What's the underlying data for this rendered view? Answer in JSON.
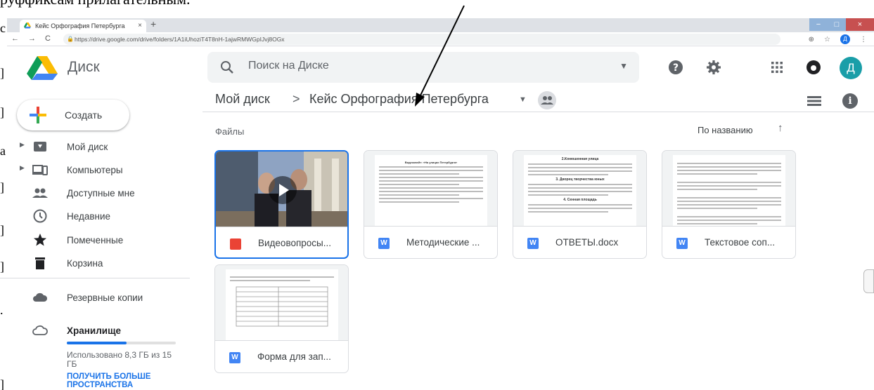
{
  "doc": {
    "top_fragment": "руффиксам прилагательным.",
    "left_marks": [
      "с",
      "]",
      "]",
      "а",
      "]",
      "]",
      "]",
      ".",
      "]"
    ]
  },
  "browser": {
    "tab_title": "Кейс Орфография Петербурга",
    "tab_close": "×",
    "new_tab": "+",
    "back": "←",
    "forward": "→",
    "reload": "C",
    "url": "https://drive.google.com/drive/folders/1A1iUhoziT4T8nH-1ajwRMWGpIJvj8OGx",
    "lock": "🔒",
    "zoom": "⊕",
    "star": "☆",
    "ext": "⋮",
    "avatar": "Д",
    "win_min": "−",
    "win_max": "□",
    "win_close": "×"
  },
  "header": {
    "brand": "Диск",
    "search_placeholder": "Поиск на Диске",
    "search_drop": "▼",
    "avatar": "Д"
  },
  "breadcrumb": {
    "root": "Мой диск",
    "sep": ">",
    "current": "Кейс Орфография Петербурга",
    "caret": "▼",
    "info": "i"
  },
  "sidebar": {
    "create_label": "Создать",
    "items": [
      {
        "label": "Мой диск",
        "arrow": "▶"
      },
      {
        "label": "Компьютеры",
        "arrow": "▶"
      },
      {
        "label": "Доступные мне",
        "arrow": ""
      },
      {
        "label": "Недавние",
        "arrow": ""
      },
      {
        "label": "Помеченные",
        "arrow": ""
      },
      {
        "label": "Корзина",
        "arrow": ""
      },
      {
        "label": "Резервные копии",
        "arrow": ""
      },
      {
        "label": "Хранилище",
        "arrow": ""
      }
    ],
    "storage_text": "Использовано 8,3 ГБ из 15 ГБ",
    "storage_fraction": 0.55,
    "upgrade": "ПОЛУЧИТЬ БОЛЬШЕ ПРОСТРАНСТВА"
  },
  "files": {
    "section_label": "Файлы",
    "sort_label": "По названию",
    "sort_arrow": "↑",
    "items": [
      {
        "name": "Видеовопросы...",
        "icon": "video-icon",
        "icon_text": ""
      },
      {
        "name": "Методические ...",
        "icon": "word-icon",
        "icon_text": "W"
      },
      {
        "name": "ОТВЕТЫ.docx",
        "icon": "word-icon",
        "icon_text": "W"
      },
      {
        "name": "Текстовое соп...",
        "icon": "word-icon",
        "icon_text": "W"
      },
      {
        "name": "Форма для зап...",
        "icon": "word-icon",
        "icon_text": "W"
      }
    ],
    "thumb_headings": {
      "doc1": "Видеоквейт: «На улицах Петербурга»",
      "doc2_a": "2.Конюшенная улица",
      "doc2_b": "3. Дворец творчества юных",
      "doc2_c": "4. Сенная площадь"
    }
  },
  "colors": {
    "accent": "#1a73e8",
    "avatar": "#1a9ea8",
    "drive_yellow": "#fbbc04",
    "drive_green": "#0f9d58",
    "drive_blue": "#4285f4",
    "video_red": "#ea4335"
  }
}
